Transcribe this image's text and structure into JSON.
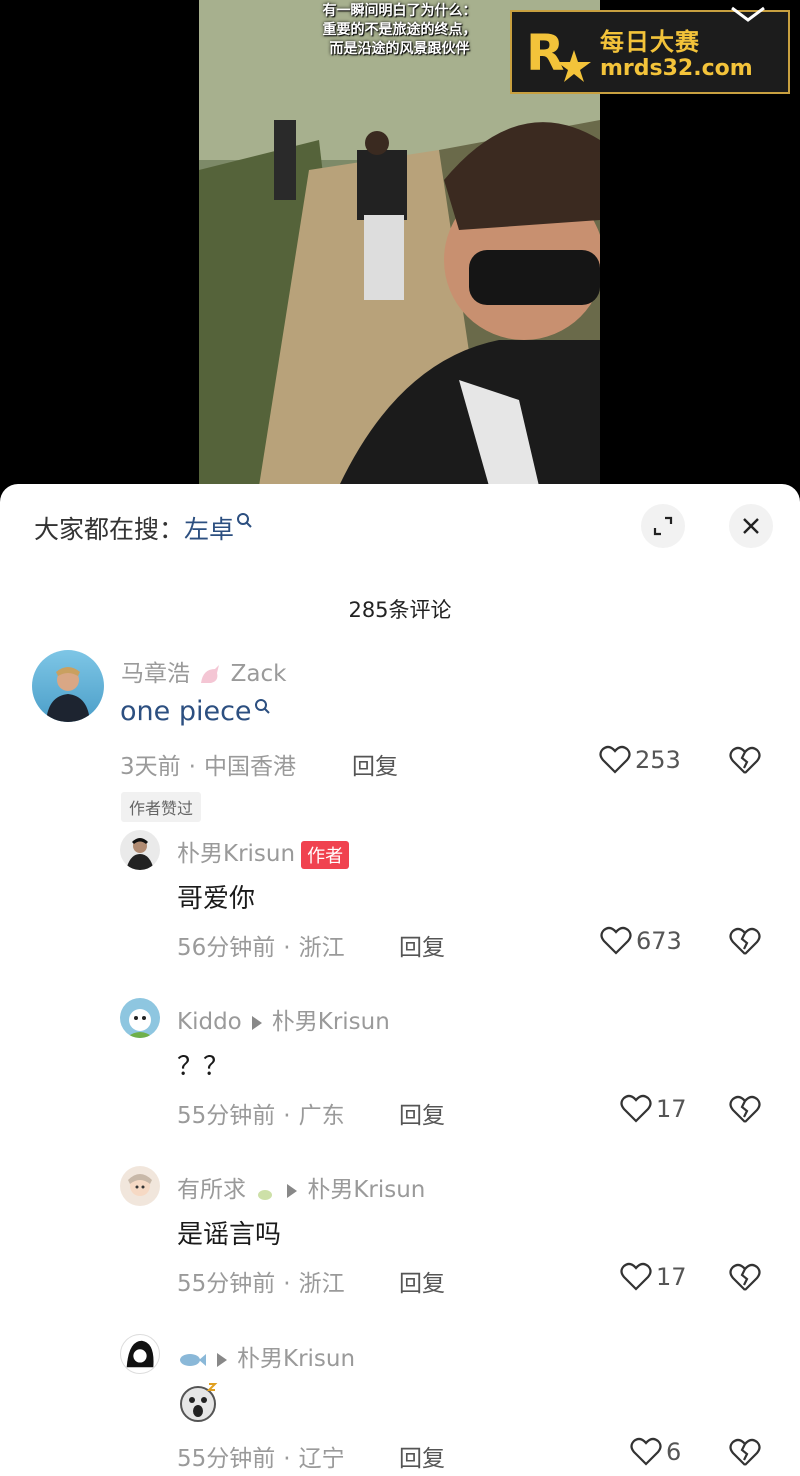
{
  "video": {
    "caption_lines": [
      "有一瞬间明白了为什么：",
      "重要的不是旅途的终点，",
      "而是沿途的风景跟伙伴"
    ]
  },
  "watermark": {
    "title": "每日大赛",
    "url": "mrds32.com"
  },
  "sheet": {
    "search_prefix": "大家都在搜：",
    "search_term": "左卓",
    "comment_count": "285条评论",
    "reply_label": "回复"
  },
  "comments": [
    {
      "user": "马章浩",
      "user_suffix": "Zack",
      "text": "one piece",
      "time": "3天前",
      "location": "中国香港",
      "likes": "253",
      "author_liked": "作者赞过"
    }
  ],
  "replies": [
    {
      "user": "朴男Krisun",
      "tag": "作者",
      "text": "哥爱你",
      "time": "56分钟前",
      "location": "浙江",
      "likes": "673"
    },
    {
      "user": "Kiddo",
      "to": "朴男Krisun",
      "text": "？？",
      "time": "55分钟前",
      "location": "广东",
      "likes": "17"
    },
    {
      "user": "有所求",
      "to": "朴男Krisun",
      "text": "是谣言吗",
      "time": "55分钟前",
      "location": "浙江",
      "likes": "17"
    },
    {
      "user": "",
      "to": "朴男Krisun",
      "text": "",
      "time": "55分钟前",
      "location": "辽宁",
      "likes": "6"
    }
  ],
  "colors": {
    "accent_link": "#2c4f80",
    "author_tag": "#f0424f",
    "watermark_gold": "#f3c33a"
  }
}
